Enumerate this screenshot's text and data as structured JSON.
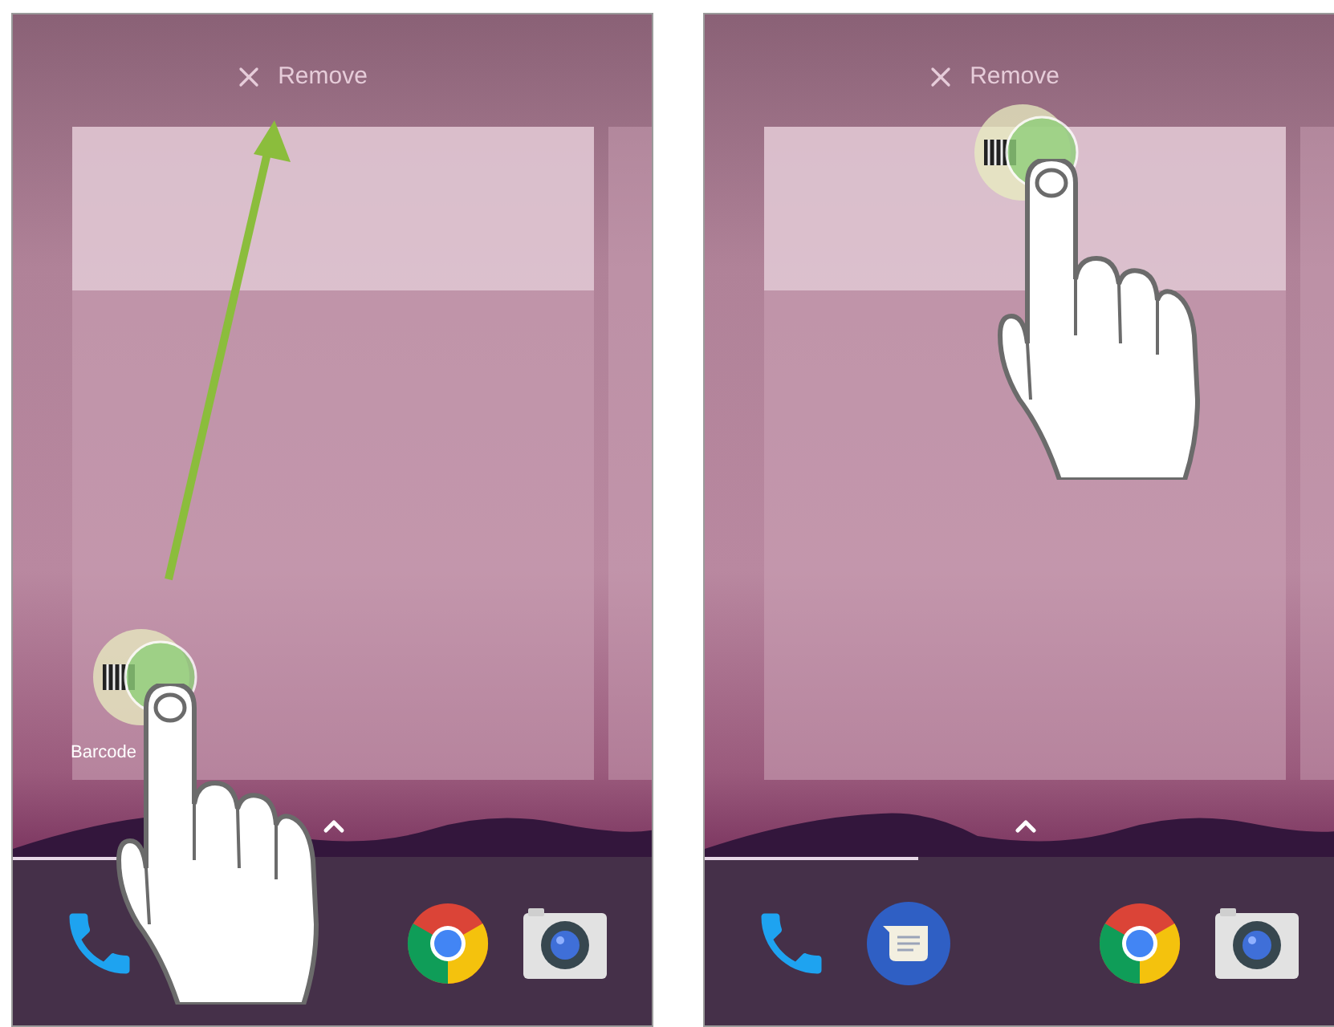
{
  "screens": [
    {
      "remove_target": {
        "label": "Remove"
      },
      "app_label": "Barcode",
      "gesture": {
        "kind": "drag",
        "arrow": true
      },
      "dock": [
        {
          "kind": "phone"
        },
        {
          "kind": "empty"
        },
        {
          "kind": "empty"
        },
        {
          "kind": "chrome"
        },
        {
          "kind": "camera"
        }
      ]
    },
    {
      "remove_target": {
        "label": "Remove"
      },
      "gesture": {
        "kind": "drop",
        "arrow": false
      },
      "dock": [
        {
          "kind": "phone"
        },
        {
          "kind": "messages"
        },
        {
          "kind": "empty"
        },
        {
          "kind": "chrome"
        },
        {
          "kind": "camera"
        }
      ]
    }
  ]
}
